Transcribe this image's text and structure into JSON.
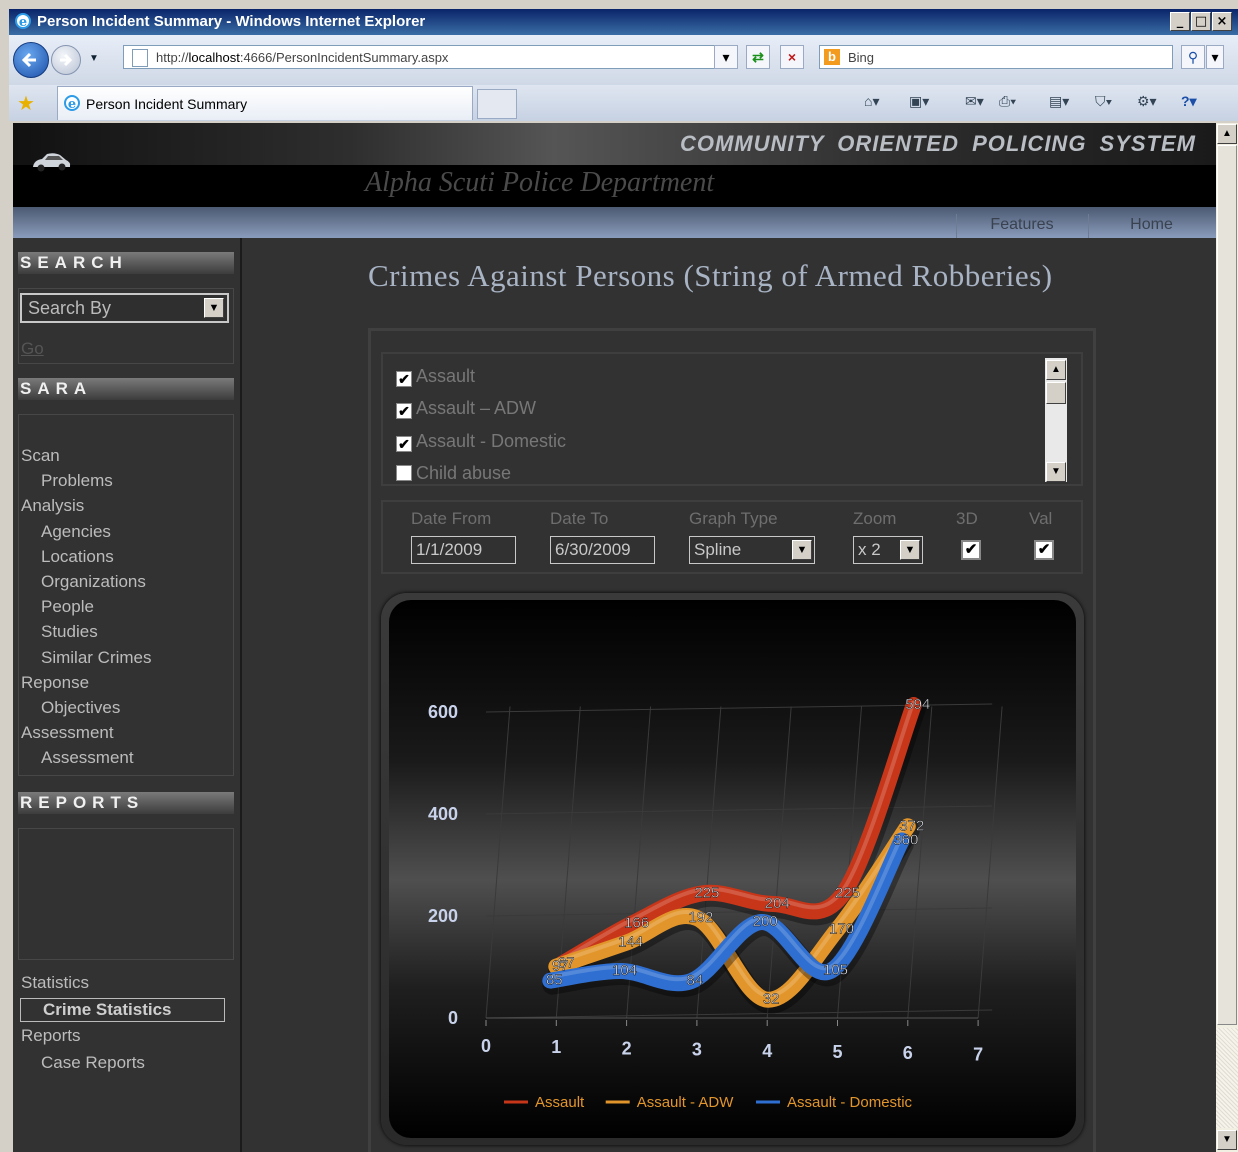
{
  "window": {
    "title": "Person Incident Summary - Windows Internet Explorer"
  },
  "browser": {
    "address_prefix": "http://",
    "address_host": "localhost",
    "address_rest": ":4666/PersonIncidentSummary.aspx",
    "search_placeholder": "Bing",
    "tab_title": "Person Incident Summary"
  },
  "site": {
    "title": "COMMUNITY ORIENTED POLICING SYSTEM",
    "department": "Alpha Scuti Police Department",
    "menu": [
      "Features",
      "Home"
    ]
  },
  "sidebar": {
    "search_header": "SEARCH",
    "search_select": "Search By",
    "go_link": "Go",
    "sara_header": "SARA",
    "sara_items": [
      {
        "label": "Scan",
        "level": 0
      },
      {
        "label": "Problems",
        "level": 1
      },
      {
        "label": "Analysis",
        "level": 0
      },
      {
        "label": "Agencies",
        "level": 1
      },
      {
        "label": "Locations",
        "level": 1
      },
      {
        "label": "Organizations",
        "level": 1
      },
      {
        "label": "People",
        "level": 1
      },
      {
        "label": "Studies",
        "level": 1
      },
      {
        "label": "Similar Crimes",
        "level": 1
      },
      {
        "label": "Reponse",
        "level": 0
      },
      {
        "label": "Objectives",
        "level": 1
      },
      {
        "label": "Assessment",
        "level": 0
      },
      {
        "label": "Assessment",
        "level": 1
      }
    ],
    "reports_header": "REPORTS",
    "report_items": [
      {
        "label": "Statistics",
        "level": 0
      },
      {
        "label": "Crime Statistics",
        "level": 1,
        "selected": true
      },
      {
        "label": "Reports",
        "level": 0
      },
      {
        "label": "Case Reports",
        "level": 1
      }
    ]
  },
  "main": {
    "title": "Crimes Against Persons (String of Armed Robberies)",
    "categories": [
      {
        "label": "Assault",
        "checked": true
      },
      {
        "label": "Assault – ADW",
        "checked": true
      },
      {
        "label": "Assault - Domestic",
        "checked": true
      },
      {
        "label": "Child abuse",
        "checked": false
      }
    ],
    "filters": {
      "date_from_label": "Date From",
      "date_from": "1/1/2009",
      "date_to_label": "Date To",
      "date_to": "6/30/2009",
      "graph_type_label": "Graph Type",
      "graph_type": "Spline",
      "zoom_label": "Zoom",
      "zoom": "x 2",
      "three_d_label": "3D",
      "three_d": true,
      "val_label": "Val",
      "val": true
    }
  },
  "chart_data": {
    "type": "line",
    "style": "3D spline",
    "x": [
      1,
      2,
      3,
      4,
      5,
      6
    ],
    "x_ticks": [
      "0",
      "1",
      "2",
      "3",
      "4",
      "5",
      "6",
      "7"
    ],
    "y_ticks": [
      "0",
      "200",
      "400",
      "600"
    ],
    "ylim": [
      0,
      650
    ],
    "series": [
      {
        "name": "Assault",
        "color": "#c8361a",
        "values": [
          87,
          166,
          225,
          204,
          225,
          594
        ]
      },
      {
        "name": "Assault - ADW",
        "color": "#e2952a",
        "values": [
          97,
          144,
          192,
          32,
          170,
          372
        ]
      },
      {
        "name": "Assault - Domestic",
        "color": "#2f6fd1",
        "values": [
          85,
          104,
          84,
          200,
          105,
          360
        ]
      }
    ],
    "legend_position": "bottom"
  }
}
